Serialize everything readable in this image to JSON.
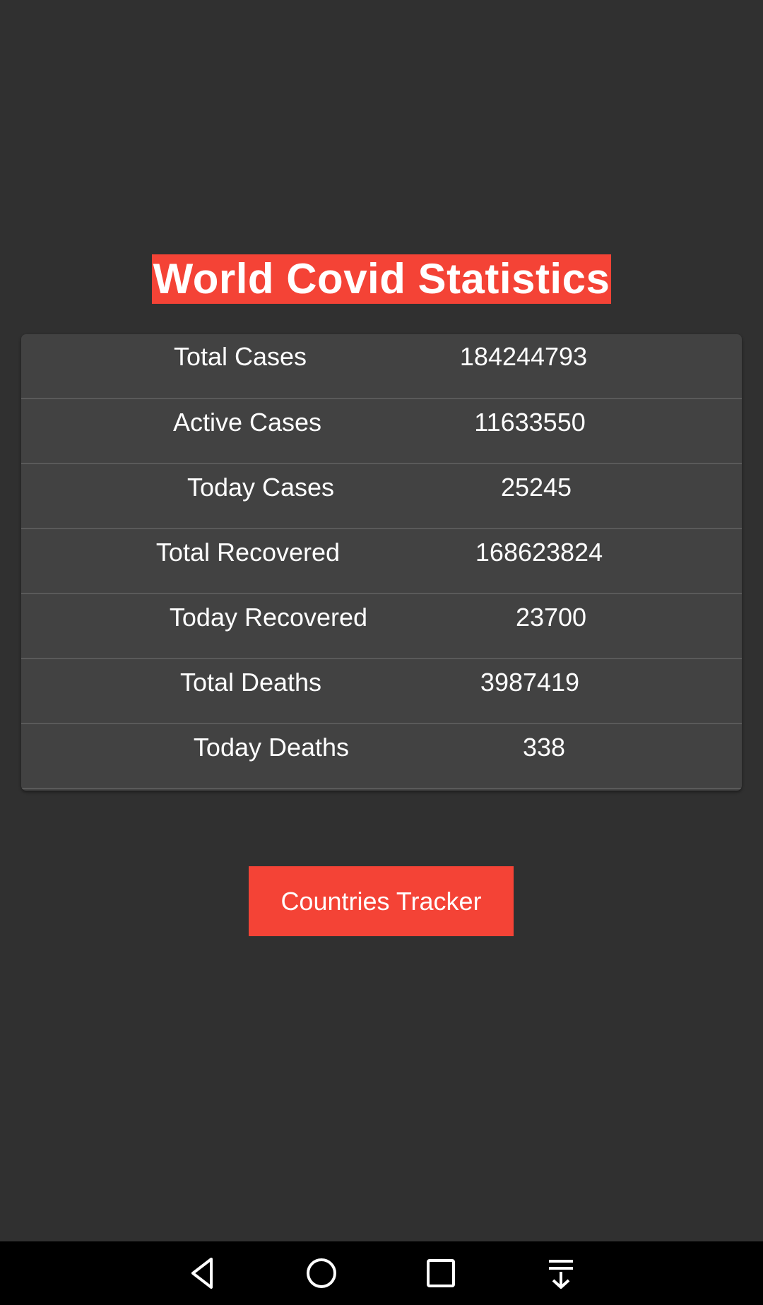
{
  "app": {
    "title": "World Covid Statistics"
  },
  "stats": [
    {
      "label": "Total Cases",
      "value": "184244793"
    },
    {
      "label": "Active Cases",
      "value": "11633550"
    },
    {
      "label": "Today Cases",
      "value": "25245"
    },
    {
      "label": "Total Recovered",
      "value": "168623824"
    },
    {
      "label": "Today Recovered",
      "value": "23700"
    },
    {
      "label": "Total Deaths",
      "value": "3987419"
    },
    {
      "label": "Today Deaths",
      "value": "338"
    }
  ],
  "actions": {
    "countries_button": "Countries Tracker"
  },
  "navbar": {
    "icons": [
      "back-icon",
      "home-icon",
      "recents-icon",
      "notification-pull-icon"
    ]
  },
  "colors": {
    "background": "#303030",
    "card": "#424242",
    "accent": "#f44336",
    "navbar": "#000000",
    "text": "#ffffff"
  }
}
